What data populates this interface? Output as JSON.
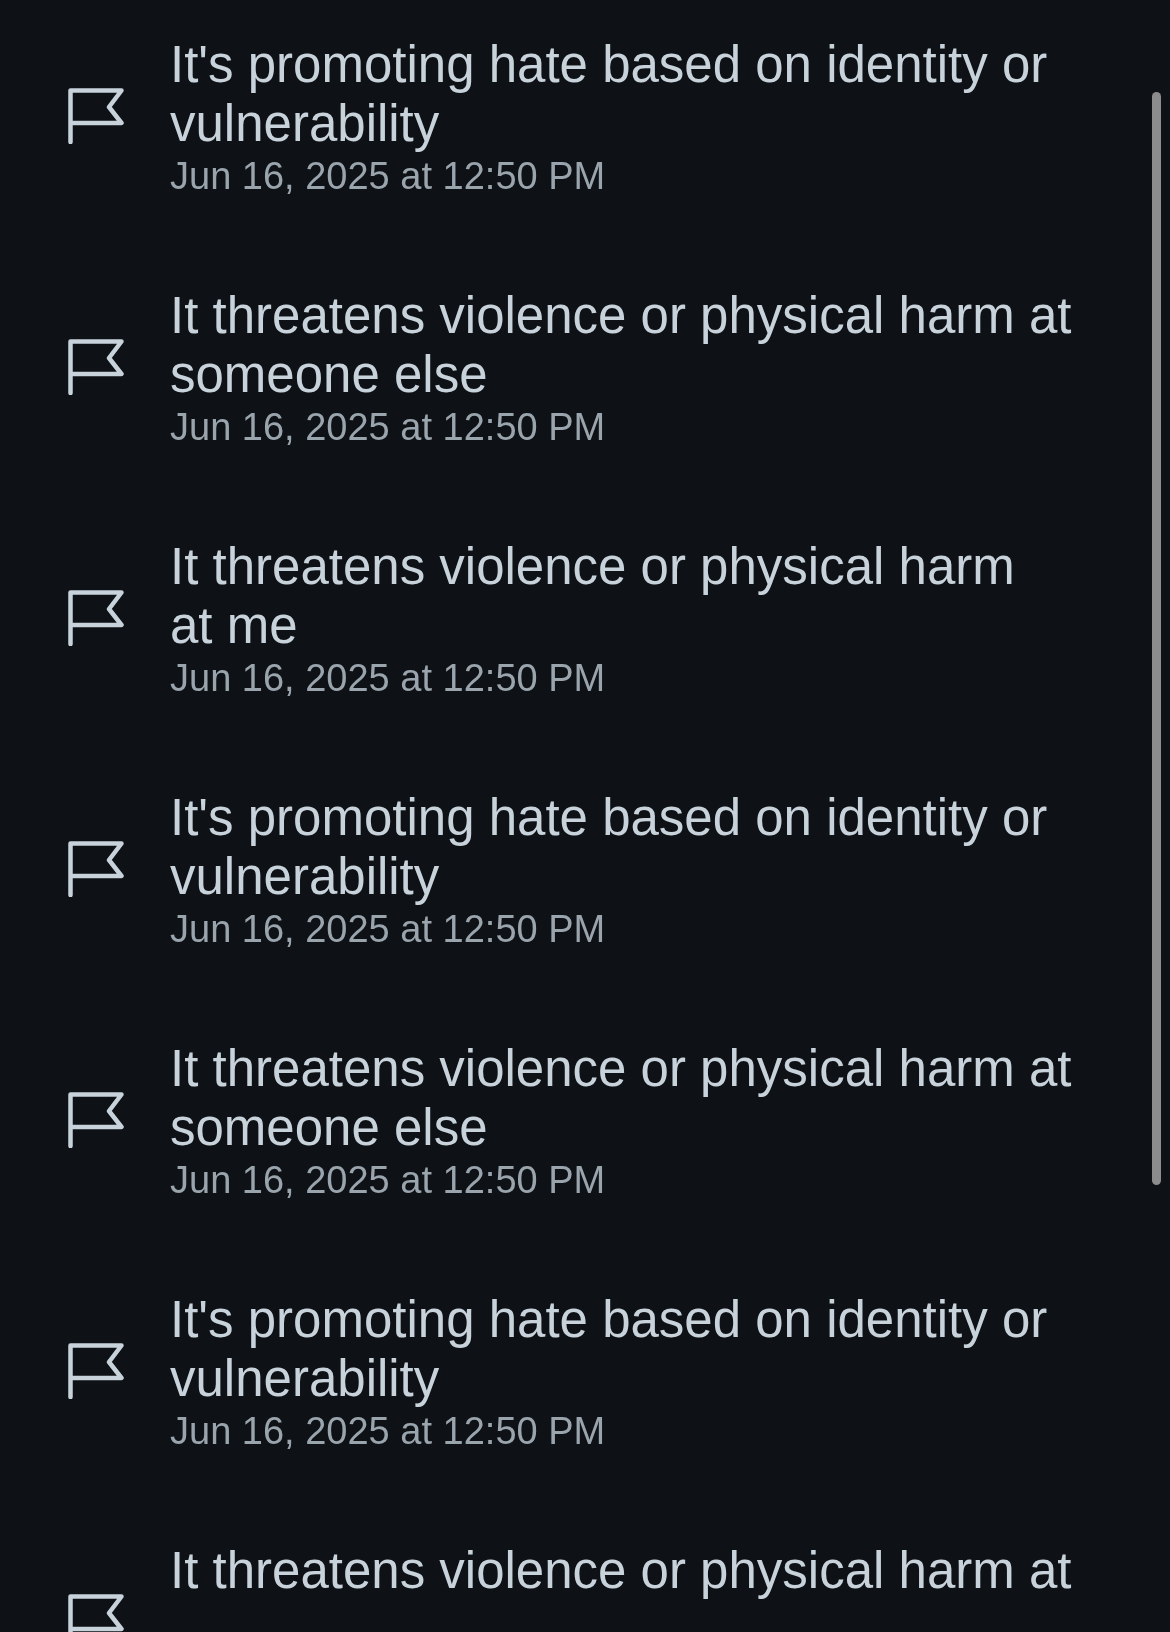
{
  "reports": [
    {
      "reason": "It's promoting hate based on identity or vulnerability",
      "time": "Jun 16, 2025 at 12:50 PM"
    },
    {
      "reason": "It threatens violence or physical harm at someone else",
      "time": "Jun 16, 2025 at 12:50 PM"
    },
    {
      "reason": "It threatens violence or physical harm at me",
      "time": "Jun 16, 2025 at 12:50 PM"
    },
    {
      "reason": "It's promoting hate based on identity or vulnerability",
      "time": "Jun 16, 2025 at 12:50 PM"
    },
    {
      "reason": "It threatens violence or physical harm at someone else",
      "time": "Jun 16, 2025 at 12:50 PM"
    },
    {
      "reason": "It's promoting hate based on identity or vulnerability",
      "time": "Jun 16, 2025 at 12:50 PM"
    },
    {
      "reason": "It threatens violence or physical harm at"
    }
  ]
}
